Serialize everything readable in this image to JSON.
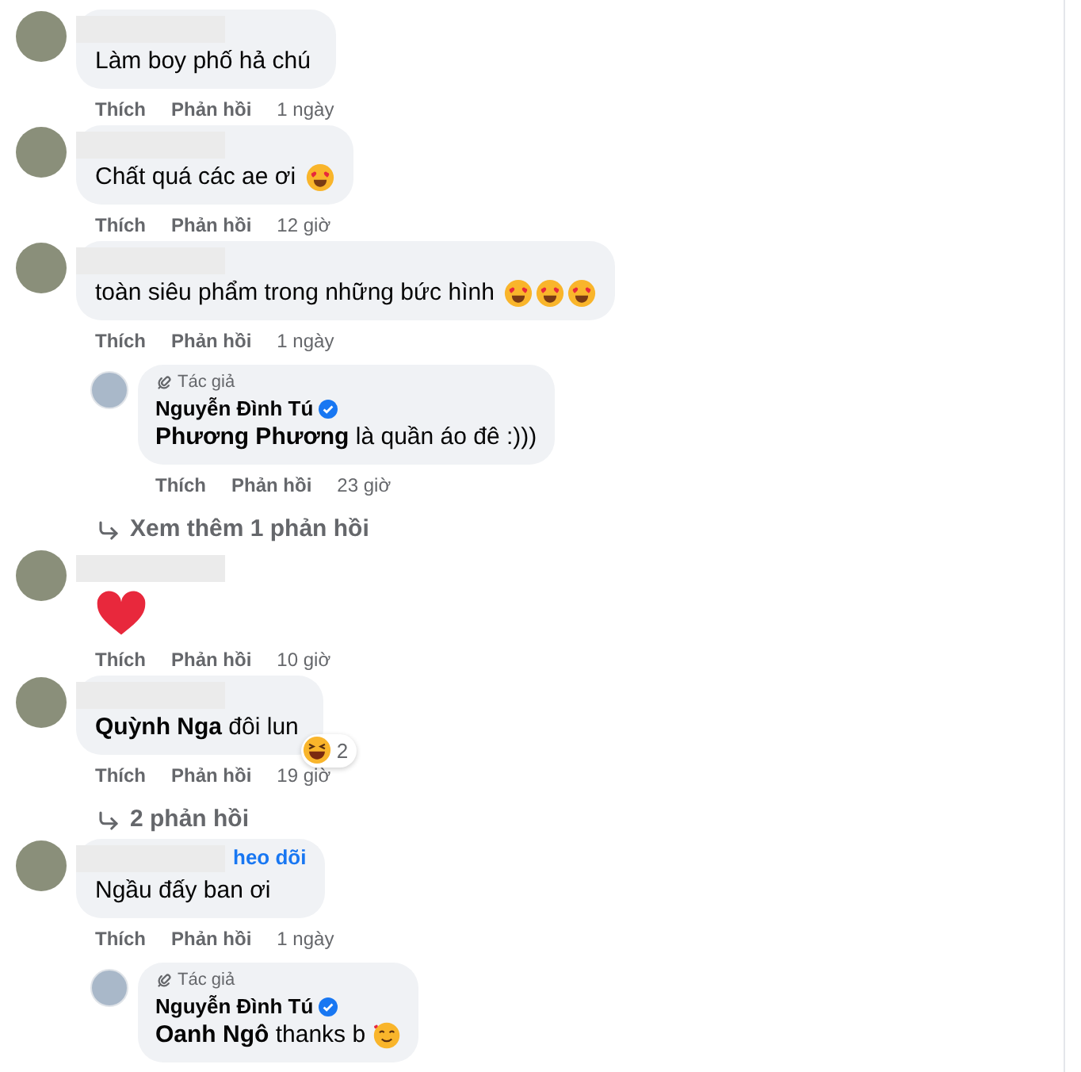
{
  "comments": [
    {
      "kind": "text",
      "redacted_name": true,
      "body": "Làm boy phố hả chú",
      "actions": [
        "Thích",
        "Phản hồi"
      ],
      "time": "1 ngày"
    },
    {
      "kind": "text",
      "redacted_name": true,
      "body": "Chất quá các ae ơi",
      "emojis": [
        {
          "kind": "heart-eyes"
        }
      ],
      "actions": [
        "Thích",
        "Phản hồi"
      ],
      "time": "12 giờ"
    },
    {
      "kind": "text",
      "redacted_name": true,
      "body": "toàn siêu phẩm trong những bức hình",
      "emojis": [
        {
          "kind": "heart-eyes"
        },
        {
          "kind": "heart-eyes"
        },
        {
          "kind": "heart-eyes"
        }
      ],
      "actions": [
        "Thích",
        "Phản hồi"
      ],
      "time": "1 ngày",
      "replies": [
        {
          "badge": "Tác giả",
          "name": "Nguyễn Đình Tú",
          "verified": true,
          "body": "**Phương Phương** là quần áo đê :)))",
          "actions": [
            "Thích",
            "Phản hồi"
          ],
          "time": "23 giờ"
        }
      ],
      "more_replies": "Xem thêm 1 phản hồi"
    },
    {
      "kind": "sticker",
      "redacted_name": true,
      "sticker": {
        "kind": "heart"
      },
      "actions": [
        "Thích",
        "Phản hồi"
      ],
      "time": "10 giờ"
    },
    {
      "kind": "text",
      "redacted_name": true,
      "body": "**Quỳnh Nga** đôi lun",
      "reaction": {
        "kind": "laughing",
        "count": "2"
      },
      "actions": [
        "Thích",
        "Phản hồi"
      ],
      "time": "19 giờ",
      "more_replies": "2 phản hồi"
    },
    {
      "kind": "text",
      "redacted_name": true,
      "follow": "heo dõi",
      "body": "Ngầu đấy ban ơi",
      "actions": [
        "Thích",
        "Phản hồi"
      ],
      "time": "1 ngày",
      "replies": [
        {
          "badge": "Tác giả",
          "name": "Nguyễn Đình Tú",
          "verified": true,
          "body": "**Oanh Ngô** thanks b",
          "emojis": [
            {
              "kind": "smiling-hearts"
            }
          ]
        }
      ]
    }
  ]
}
